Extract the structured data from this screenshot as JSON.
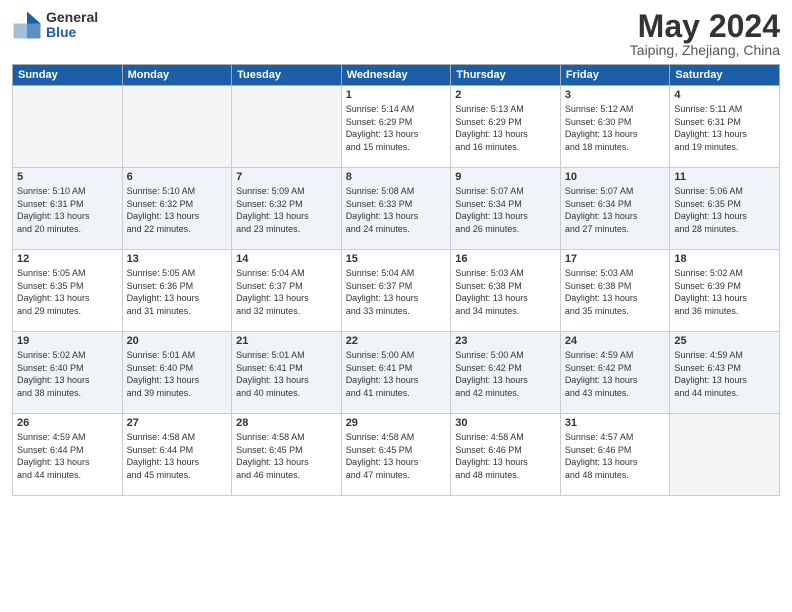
{
  "logo": {
    "general": "General",
    "blue": "Blue"
  },
  "title": {
    "month_year": "May 2024",
    "location": "Taiping, Zhejiang, China"
  },
  "weekdays": [
    "Sunday",
    "Monday",
    "Tuesday",
    "Wednesday",
    "Thursday",
    "Friday",
    "Saturday"
  ],
  "weeks": [
    [
      {
        "day": "",
        "info": ""
      },
      {
        "day": "",
        "info": ""
      },
      {
        "day": "",
        "info": ""
      },
      {
        "day": "1",
        "info": "Sunrise: 5:14 AM\nSunset: 6:29 PM\nDaylight: 13 hours\nand 15 minutes."
      },
      {
        "day": "2",
        "info": "Sunrise: 5:13 AM\nSunset: 6:29 PM\nDaylight: 13 hours\nand 16 minutes."
      },
      {
        "day": "3",
        "info": "Sunrise: 5:12 AM\nSunset: 6:30 PM\nDaylight: 13 hours\nand 18 minutes."
      },
      {
        "day": "4",
        "info": "Sunrise: 5:11 AM\nSunset: 6:31 PM\nDaylight: 13 hours\nand 19 minutes."
      }
    ],
    [
      {
        "day": "5",
        "info": "Sunrise: 5:10 AM\nSunset: 6:31 PM\nDaylight: 13 hours\nand 20 minutes."
      },
      {
        "day": "6",
        "info": "Sunrise: 5:10 AM\nSunset: 6:32 PM\nDaylight: 13 hours\nand 22 minutes."
      },
      {
        "day": "7",
        "info": "Sunrise: 5:09 AM\nSunset: 6:32 PM\nDaylight: 13 hours\nand 23 minutes."
      },
      {
        "day": "8",
        "info": "Sunrise: 5:08 AM\nSunset: 6:33 PM\nDaylight: 13 hours\nand 24 minutes."
      },
      {
        "day": "9",
        "info": "Sunrise: 5:07 AM\nSunset: 6:34 PM\nDaylight: 13 hours\nand 26 minutes."
      },
      {
        "day": "10",
        "info": "Sunrise: 5:07 AM\nSunset: 6:34 PM\nDaylight: 13 hours\nand 27 minutes."
      },
      {
        "day": "11",
        "info": "Sunrise: 5:06 AM\nSunset: 6:35 PM\nDaylight: 13 hours\nand 28 minutes."
      }
    ],
    [
      {
        "day": "12",
        "info": "Sunrise: 5:05 AM\nSunset: 6:35 PM\nDaylight: 13 hours\nand 29 minutes."
      },
      {
        "day": "13",
        "info": "Sunrise: 5:05 AM\nSunset: 6:36 PM\nDaylight: 13 hours\nand 31 minutes."
      },
      {
        "day": "14",
        "info": "Sunrise: 5:04 AM\nSunset: 6:37 PM\nDaylight: 13 hours\nand 32 minutes."
      },
      {
        "day": "15",
        "info": "Sunrise: 5:04 AM\nSunset: 6:37 PM\nDaylight: 13 hours\nand 33 minutes."
      },
      {
        "day": "16",
        "info": "Sunrise: 5:03 AM\nSunset: 6:38 PM\nDaylight: 13 hours\nand 34 minutes."
      },
      {
        "day": "17",
        "info": "Sunrise: 5:03 AM\nSunset: 6:38 PM\nDaylight: 13 hours\nand 35 minutes."
      },
      {
        "day": "18",
        "info": "Sunrise: 5:02 AM\nSunset: 6:39 PM\nDaylight: 13 hours\nand 36 minutes."
      }
    ],
    [
      {
        "day": "19",
        "info": "Sunrise: 5:02 AM\nSunset: 6:40 PM\nDaylight: 13 hours\nand 38 minutes."
      },
      {
        "day": "20",
        "info": "Sunrise: 5:01 AM\nSunset: 6:40 PM\nDaylight: 13 hours\nand 39 minutes."
      },
      {
        "day": "21",
        "info": "Sunrise: 5:01 AM\nSunset: 6:41 PM\nDaylight: 13 hours\nand 40 minutes."
      },
      {
        "day": "22",
        "info": "Sunrise: 5:00 AM\nSunset: 6:41 PM\nDaylight: 13 hours\nand 41 minutes."
      },
      {
        "day": "23",
        "info": "Sunrise: 5:00 AM\nSunset: 6:42 PM\nDaylight: 13 hours\nand 42 minutes."
      },
      {
        "day": "24",
        "info": "Sunrise: 4:59 AM\nSunset: 6:42 PM\nDaylight: 13 hours\nand 43 minutes."
      },
      {
        "day": "25",
        "info": "Sunrise: 4:59 AM\nSunset: 6:43 PM\nDaylight: 13 hours\nand 44 minutes."
      }
    ],
    [
      {
        "day": "26",
        "info": "Sunrise: 4:59 AM\nSunset: 6:44 PM\nDaylight: 13 hours\nand 44 minutes."
      },
      {
        "day": "27",
        "info": "Sunrise: 4:58 AM\nSunset: 6:44 PM\nDaylight: 13 hours\nand 45 minutes."
      },
      {
        "day": "28",
        "info": "Sunrise: 4:58 AM\nSunset: 6:45 PM\nDaylight: 13 hours\nand 46 minutes."
      },
      {
        "day": "29",
        "info": "Sunrise: 4:58 AM\nSunset: 6:45 PM\nDaylight: 13 hours\nand 47 minutes."
      },
      {
        "day": "30",
        "info": "Sunrise: 4:58 AM\nSunset: 6:46 PM\nDaylight: 13 hours\nand 48 minutes."
      },
      {
        "day": "31",
        "info": "Sunrise: 4:57 AM\nSunset: 6:46 PM\nDaylight: 13 hours\nand 48 minutes."
      },
      {
        "day": "",
        "info": ""
      }
    ]
  ]
}
